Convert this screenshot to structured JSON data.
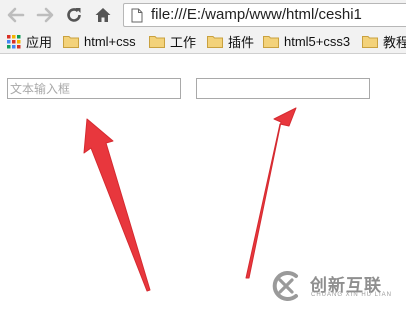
{
  "browser": {
    "url": "file:///E:/wamp/www/html/ceshi1"
  },
  "bookmarks": [
    {
      "label": "应用",
      "icon": "apps-grid-icon"
    },
    {
      "label": "html+css",
      "icon": "folder-icon"
    },
    {
      "label": "工作",
      "icon": "folder-icon"
    },
    {
      "label": "插件",
      "icon": "folder-icon"
    },
    {
      "label": "html5+css3",
      "icon": "folder-icon"
    },
    {
      "label": "教程",
      "icon": "folder-icon"
    }
  ],
  "page": {
    "input1": {
      "placeholder": "文本输入框",
      "value": ""
    },
    "input2": {
      "placeholder": "",
      "value": ""
    }
  },
  "annotations": {
    "arrow_color": "#e8373d"
  },
  "watermark": {
    "logo": "chuangxin-logo",
    "main_text": "创新互联",
    "sub_text": "CHUANG XIN HU LIAN"
  }
}
